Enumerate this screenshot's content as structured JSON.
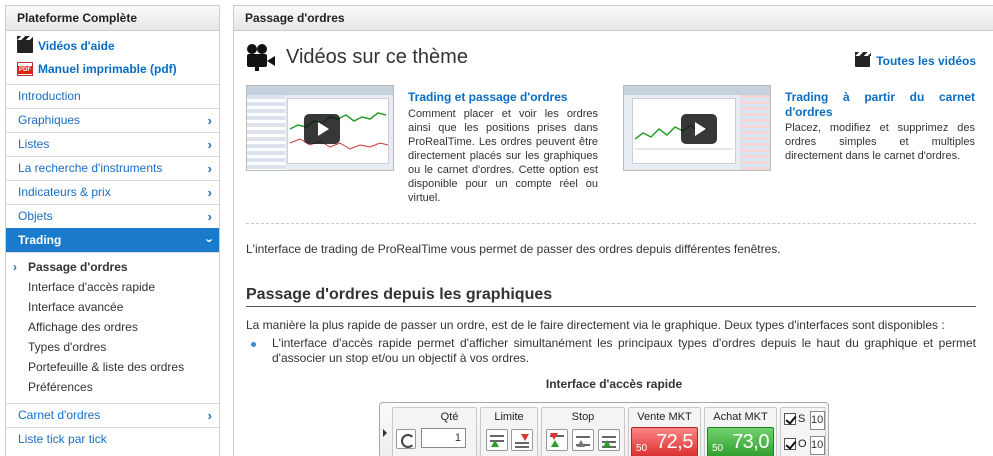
{
  "sidebar": {
    "title": "Plateforme Complète",
    "links": [
      {
        "label": "Vidéos d'aide",
        "icon": "clapperboard-icon"
      },
      {
        "label": "Manuel imprimable (pdf)",
        "icon": "pdf-icon"
      }
    ],
    "menu": [
      {
        "label": "Introduction"
      },
      {
        "label": "Graphiques"
      },
      {
        "label": "Listes"
      },
      {
        "label": "La recherche d'instruments"
      },
      {
        "label": "Indicateurs & prix"
      },
      {
        "label": "Objets"
      },
      {
        "label": "Trading"
      }
    ],
    "submenu": [
      "Passage d'ordres",
      "Interface d'accès rapide",
      "Interface avancée",
      "Affichage des ordres",
      "Types d'ordres",
      "Portefeuille & liste des ordres",
      "Préférences"
    ],
    "menu_after": [
      {
        "label": "Carnet d'ordres"
      },
      {
        "label": "Liste tick par tick"
      }
    ]
  },
  "main": {
    "header": "Passage d'ordres",
    "videos_title": "Vidéos sur ce thème",
    "all_videos": "Toutes les vidéos",
    "videos": [
      {
        "title": "Trading et passage d'ordres",
        "description": "Comment placer et voir les ordres ainsi que les positions prises dans ProRealTime. Les ordres peuvent être directement placés sur les graphiques ou le carnet d'ordres. Cette option est disponible pour un compte réel ou virtuel."
      },
      {
        "title": "Trading à partir du carnet d'ordres",
        "description": "Placez, modifiez et supprimez des ordres simples et multiples directement dans le carnet d'ordres."
      }
    ],
    "intro": "L'interface de trading de ProRealTime vous permet de passer des ordres depuis différentes fenêtres.",
    "section_title": "Passage d'ordres depuis les graphiques",
    "paragraph": "La manière la plus rapide de passer un ordre, est de le faire directement via le graphique. Deux types d'interfaces sont disponibles :",
    "bullet": "L'interface d'accès rapide permet d'afficher simultanément les principaux types d'ordres depuis le haut du graphique et permet d'associer un stop et/ou un objectif à vos ordres.",
    "figure_caption": "Interface d'accès rapide"
  },
  "toolbar": {
    "qty_label": "Qté",
    "qty_value": "1",
    "limit_label": "Limite",
    "stop_label": "Stop",
    "sell_label": "Vente MKT",
    "buy_label": "Achat MKT",
    "sell_small": "50",
    "sell_price": "72,5",
    "buy_small": "50",
    "buy_price": "73,0",
    "s_label": "S",
    "o_label": "O",
    "s_value": "10",
    "o_value": "10",
    "colors": {
      "sell": "#d82a2a",
      "buy": "#2e9b2b",
      "accent": "#1a7acb"
    }
  }
}
